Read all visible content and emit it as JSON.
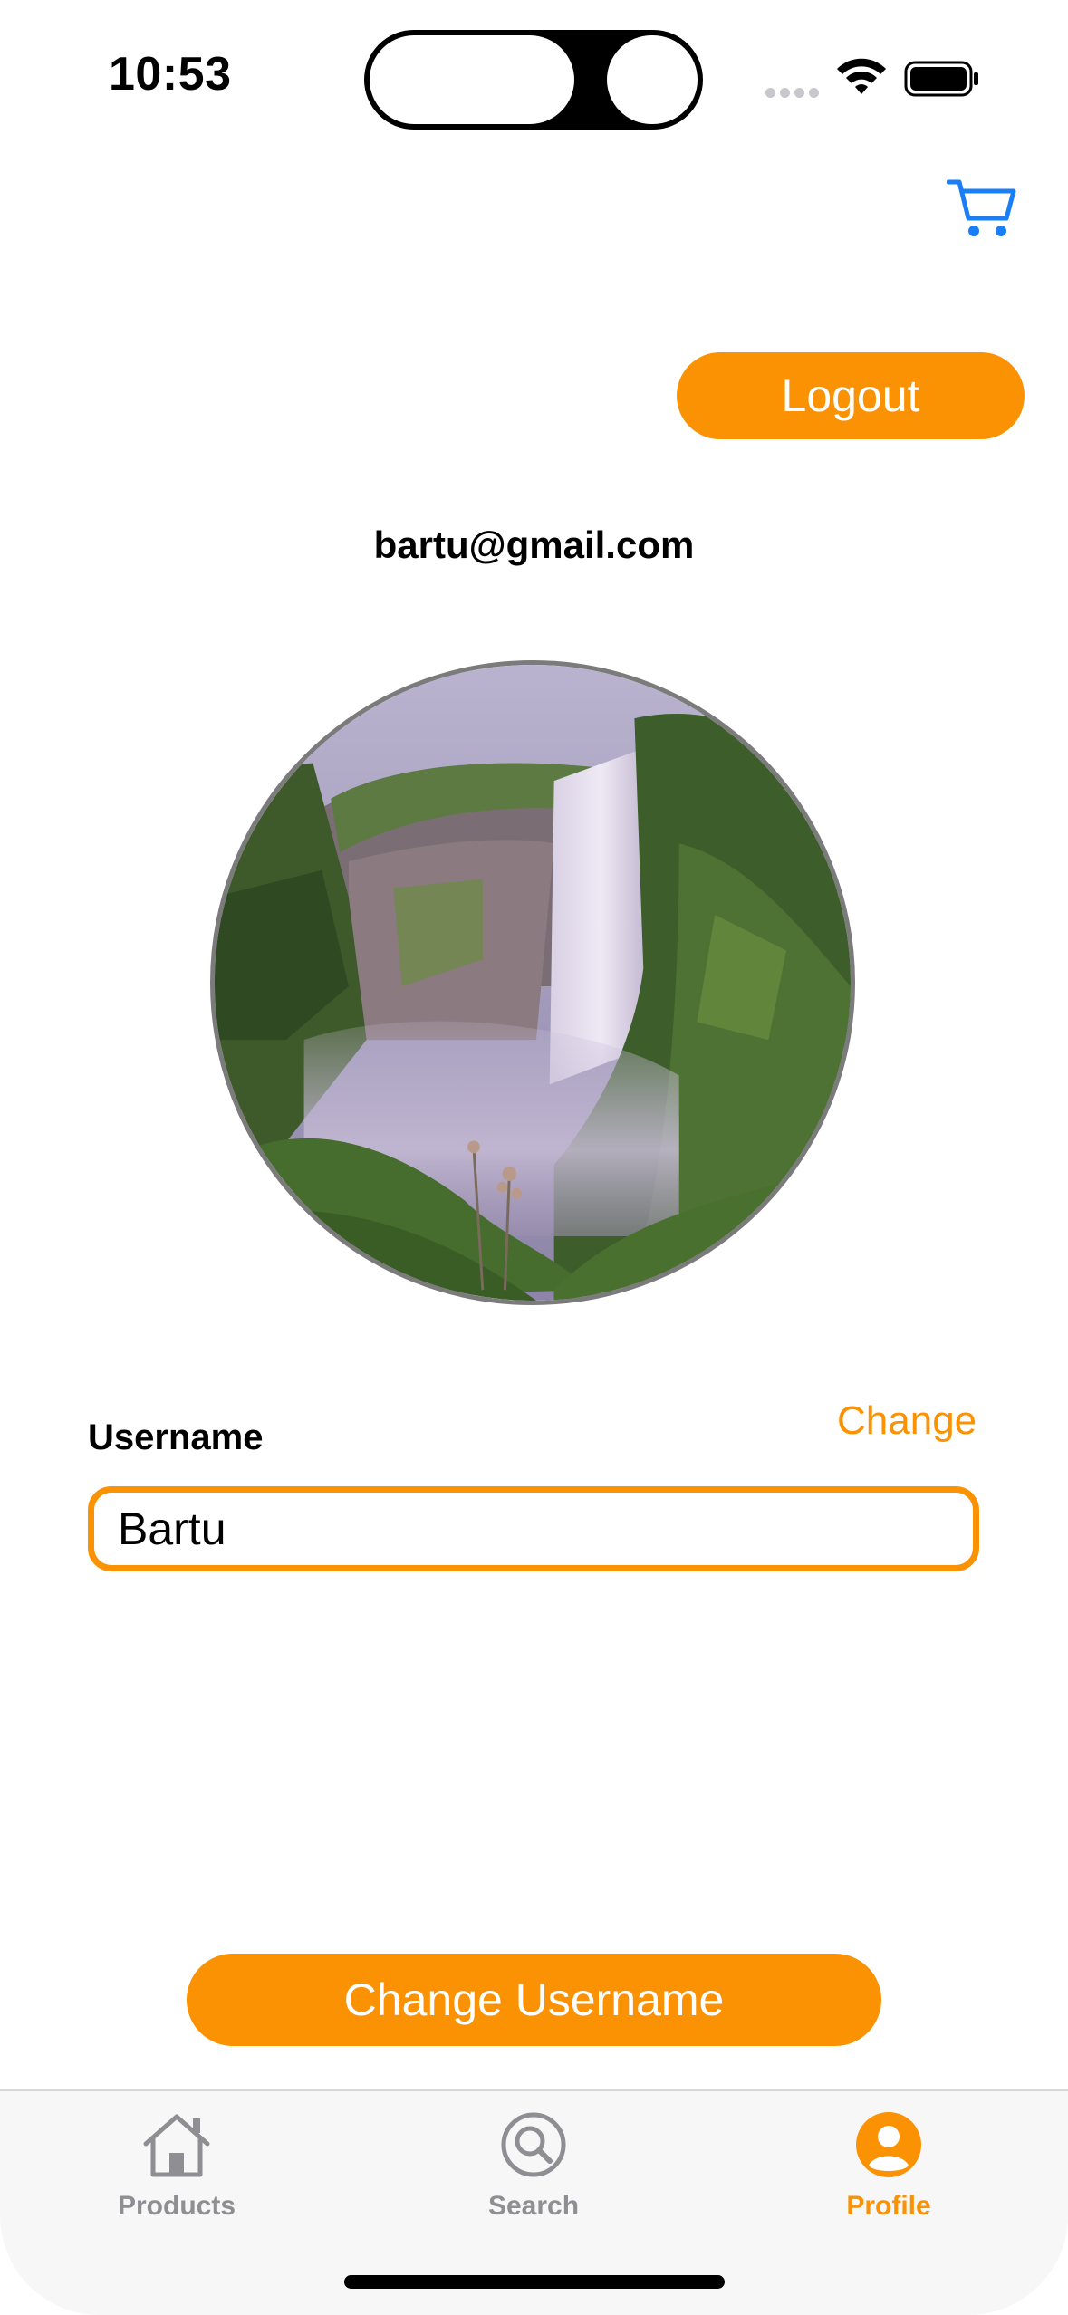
{
  "status_bar": {
    "time": "10:53"
  },
  "header": {
    "cart_icon": "cart-icon"
  },
  "profile": {
    "logout_label": "Logout",
    "email": "bartu@gmail.com",
    "avatar_icon": "waterfall-photo"
  },
  "username_section": {
    "label": "Username",
    "change_label": "Change",
    "value": "Bartu"
  },
  "actions": {
    "change_username_label": "Change Username"
  },
  "tab_bar": {
    "tabs": [
      {
        "label": "Products",
        "icon": "house-icon",
        "active": false
      },
      {
        "label": "Search",
        "icon": "magnifier-icon",
        "active": false
      },
      {
        "label": "Profile",
        "icon": "person-circle-icon",
        "active": true
      }
    ]
  },
  "colors": {
    "accent": "#fb9203",
    "link_blue": "#1a7ef7",
    "inactive": "#8e8e93"
  }
}
